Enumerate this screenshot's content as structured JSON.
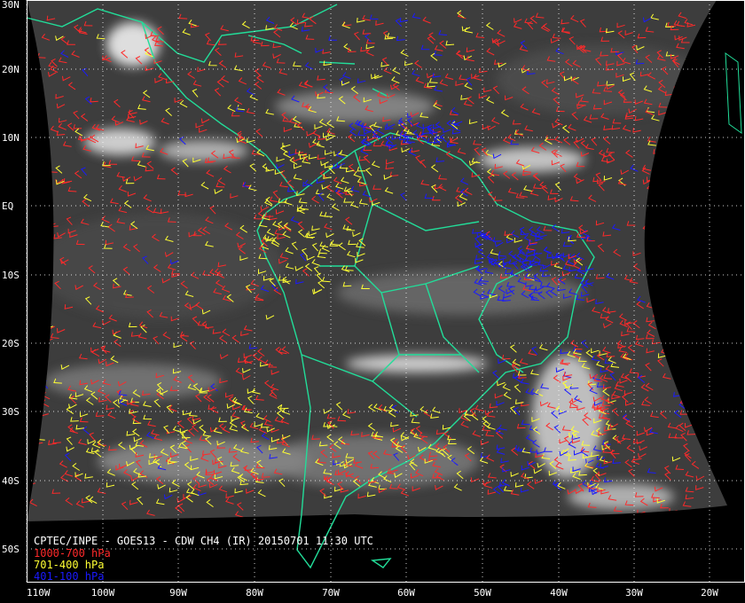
{
  "product": {
    "title": "CPTEC/INPE - GOES13 - CDW CH4 (IR) 20150701 11:30 UTC"
  },
  "legend": [
    {
      "label": "1000-700 hPa",
      "color": "#ff2a2a"
    },
    {
      "label": "701-400 hPa",
      "color": "#ffff33"
    },
    {
      "label": "401-100 hPa",
      "color": "#1a1aff"
    }
  ],
  "latitude_labels": [
    "30N",
    "20N",
    "10N",
    "EQ",
    "10S",
    "20S",
    "30S",
    "40S",
    "50S"
  ],
  "longitude_labels": [
    "110W",
    "100W",
    "90W",
    "80W",
    "70W",
    "60W",
    "50W",
    "40W",
    "30W",
    "20W"
  ],
  "colors": {
    "coastline": "#22dd99",
    "grid": "#ffffff",
    "space": "#000000",
    "cloud_free": "#3a3a3a",
    "cloud": "#e8e8e8"
  }
}
